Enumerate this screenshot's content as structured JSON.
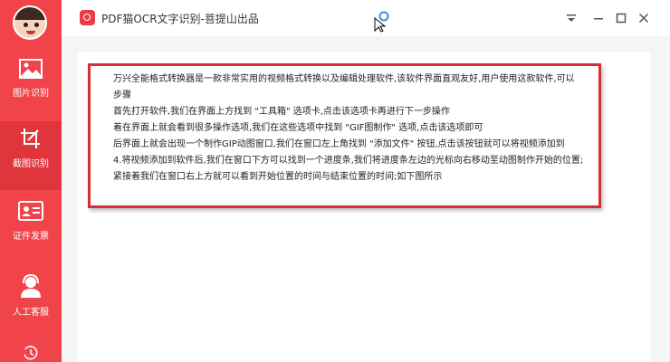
{
  "app": {
    "title": "PDF猫OCR文字识别-菩提山出品",
    "accent_color": "#f0434a"
  },
  "sidebar": {
    "items": [
      {
        "label": "图片识别",
        "icon": "image-icon"
      },
      {
        "label": "截图识别",
        "icon": "crop-icon",
        "active": true
      },
      {
        "label": "证件发票",
        "icon": "id-card-icon"
      },
      {
        "label": "人工客服",
        "icon": "customer-service-icon"
      },
      {
        "label": "",
        "icon": "history-icon"
      }
    ]
  },
  "window_controls": {
    "menu": "dropdown-icon",
    "minimize": "minimize-icon",
    "maximize": "maximize-icon",
    "close": "close-icon"
  },
  "document": {
    "lines": [
      "万兴全能格式转换器是一款非常实用的视频格式转换以及编辑处理软件,该软件界面直观友好,用户使用这款软件,可以",
      "步骤",
      "首先打开软件,我们在界面上方找到 \"工具箱\" 选项卡,点击该选项卡再进行下一步操作",
      "着在界面上就会看到很多操作选项,我们在这些选项中找到 \"GIF图制作\" 选项,点击该选项即可",
      "后界面上就会出现一个制作GIP动图窗口,我们在窗口左上角找到 \"添加文件\" 按钮,点击该按钮就可以将视频添加到",
      "4.将视频添加到软件后,我们在窗口下方可以找到一个进度条,我们将进度条左边的光标向右移动至动图制作开始的位置;",
      "紧接着我们在窗口右上方就可以看到开始位置的时间与结束位置的时间;如下图所示"
    ]
  }
}
